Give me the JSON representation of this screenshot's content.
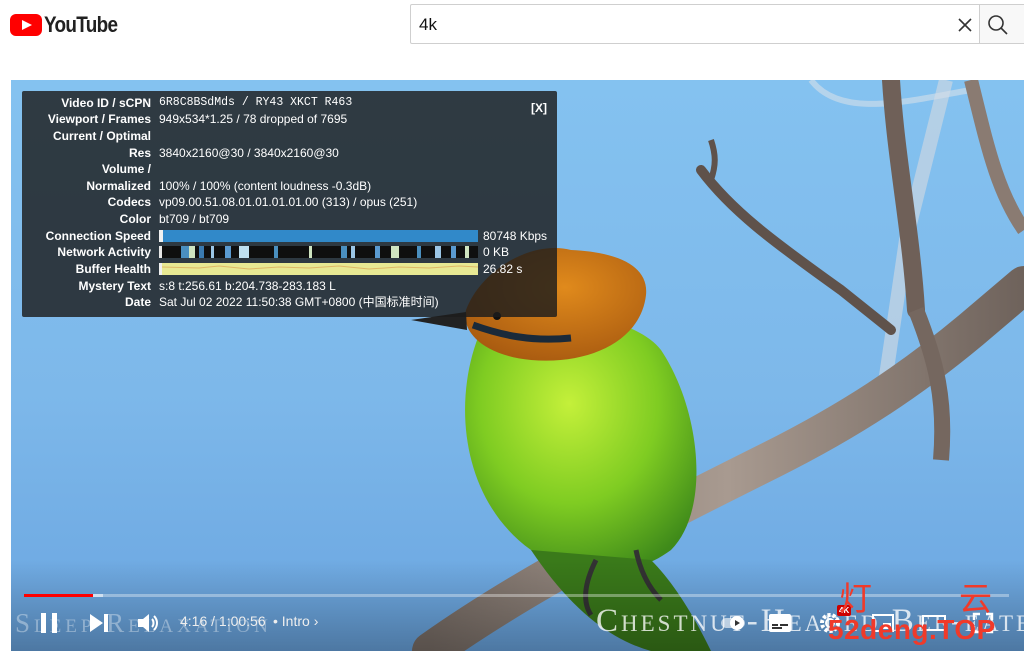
{
  "app": {
    "logo_text": "YouTube",
    "brand_color": "#ff0000"
  },
  "search": {
    "value": "4k"
  },
  "stats": {
    "close_label": "[X]",
    "rows": [
      {
        "label": "Video ID / sCPN",
        "value": "6R8C8BSdMds / RY43 XKCT R463"
      },
      {
        "label": "Viewport / Frames",
        "value": "949x534*1.25 / 78 dropped of 7695"
      },
      {
        "label": "Current / Optimal",
        "value": ""
      },
      {
        "label": "Res",
        "value": "3840x2160@30 / 3840x2160@30"
      },
      {
        "label": "Volume /",
        "value": ""
      },
      {
        "label": "Normalized",
        "value": "100% / 100% (content loudness -0.3dB)"
      },
      {
        "label": "Codecs",
        "value": "vp09.00.51.08.01.01.01.01.00 (313) / opus (251)"
      },
      {
        "label": "Color",
        "value": "bt709 / bt709"
      }
    ],
    "connection_speed": {
      "label": "Connection Speed",
      "value": "80748 Kbps",
      "color": "#3189c9"
    },
    "network_activity": {
      "label": "Network Activity",
      "value": "0 KB"
    },
    "buffer_health": {
      "label": "Buffer Health",
      "value": "26.82 s",
      "color": "#e8e993"
    },
    "mystery_text": {
      "label": "Mystery Text",
      "value": "s:8 t:256.61 b:204.738-283.183 L"
    },
    "date": {
      "label": "Date",
      "value": "Sat Jul 02 2022 11:50:38 GMT+0800 (中国标准时间)"
    }
  },
  "player": {
    "time": "4:16 / 1:00:56",
    "chapter": "• Intro",
    "played_fraction": 0.07,
    "buffered_fraction": 0.08,
    "quality_badge": "4K",
    "watermark_title": "Chestnut-Headed Bee-eater",
    "watermark_left": "Sleep Relaxation"
  },
  "site_watermark": {
    "char1": "灯",
    "char2": "云",
    "domain": "52deng.TOP"
  }
}
